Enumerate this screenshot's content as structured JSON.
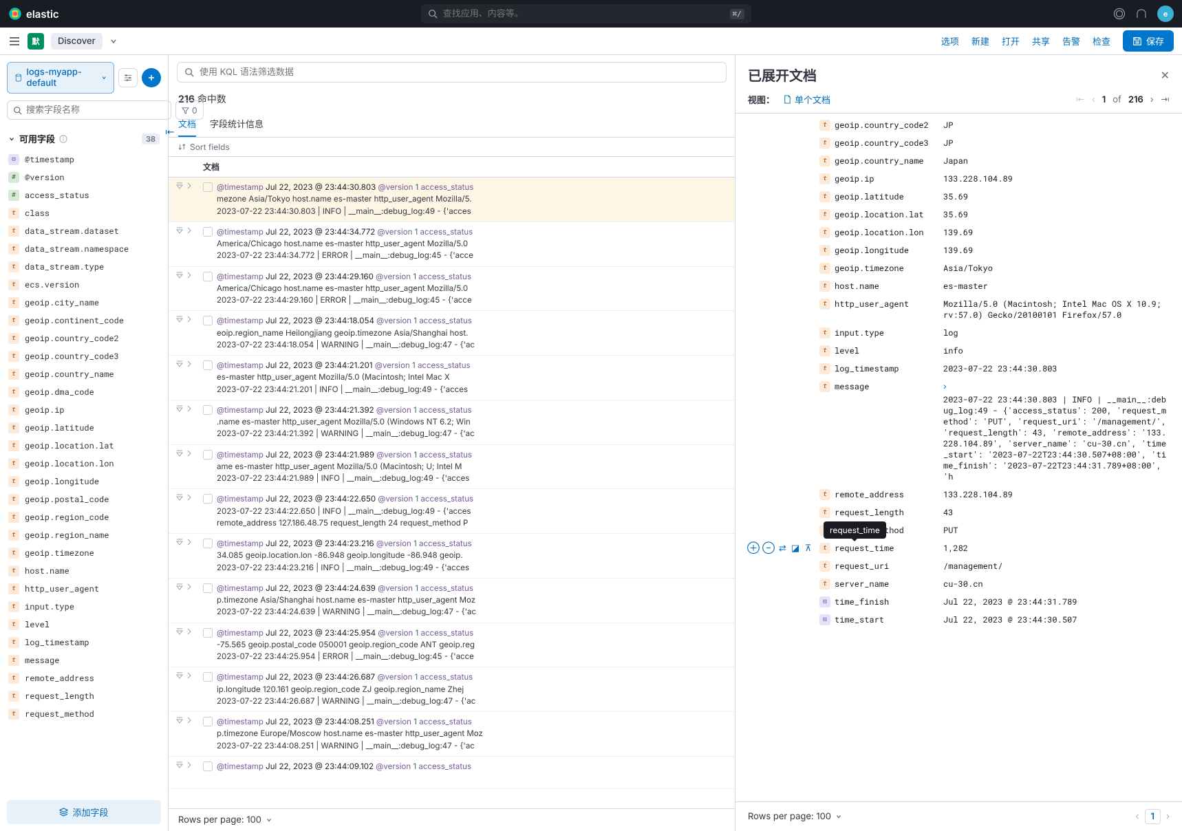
{
  "topbar": {
    "brand": "elastic",
    "search_placeholder": "查找应用、内容等。",
    "shortcut": "⌘/",
    "avatar": "e"
  },
  "subbar": {
    "badge": "默",
    "title": "Discover",
    "links": [
      "选项",
      "新建",
      "打开",
      "共享",
      "告警",
      "检查"
    ],
    "save": "保存"
  },
  "sidebar": {
    "datasource": "logs-myapp-default",
    "field_search_placeholder": "搜索字段名称",
    "filter_count": "0",
    "section": "可用字段",
    "section_count": "38",
    "fields": [
      {
        "t": "date",
        "n": "@timestamp"
      },
      {
        "t": "num",
        "n": "@version"
      },
      {
        "t": "num",
        "n": "access_status"
      },
      {
        "t": "text",
        "n": "class"
      },
      {
        "t": "text",
        "n": "data_stream.dataset"
      },
      {
        "t": "text",
        "n": "data_stream.namespace"
      },
      {
        "t": "text",
        "n": "data_stream.type"
      },
      {
        "t": "text",
        "n": "ecs.version"
      },
      {
        "t": "text",
        "n": "geoip.city_name"
      },
      {
        "t": "text",
        "n": "geoip.continent_code"
      },
      {
        "t": "text",
        "n": "geoip.country_code2"
      },
      {
        "t": "text",
        "n": "geoip.country_code3"
      },
      {
        "t": "text",
        "n": "geoip.country_name"
      },
      {
        "t": "text",
        "n": "geoip.dma_code"
      },
      {
        "t": "text",
        "n": "geoip.ip"
      },
      {
        "t": "text",
        "n": "geoip.latitude"
      },
      {
        "t": "text",
        "n": "geoip.location.lat"
      },
      {
        "t": "text",
        "n": "geoip.location.lon"
      },
      {
        "t": "text",
        "n": "geoip.longitude"
      },
      {
        "t": "text",
        "n": "geoip.postal_code"
      },
      {
        "t": "text",
        "n": "geoip.region_code"
      },
      {
        "t": "text",
        "n": "geoip.region_name"
      },
      {
        "t": "text",
        "n": "geoip.timezone"
      },
      {
        "t": "text",
        "n": "host.name"
      },
      {
        "t": "text",
        "n": "http_user_agent"
      },
      {
        "t": "text",
        "n": "input.type"
      },
      {
        "t": "text",
        "n": "level"
      },
      {
        "t": "text",
        "n": "log_timestamp"
      },
      {
        "t": "text",
        "n": "message"
      },
      {
        "t": "text",
        "n": "remote_address"
      },
      {
        "t": "text",
        "n": "request_length"
      },
      {
        "t": "text",
        "n": "request_method"
      }
    ],
    "add_field": "添加字段"
  },
  "query": {
    "placeholder": "使用 KQL 语法筛选数据",
    "hits_count": "216",
    "hits_label": " 命中数",
    "tabs": [
      "文档",
      "字段统计信息"
    ],
    "sort_label": "Sort fields",
    "col_header": "文档",
    "rows_per_page": "Rows per page: 100"
  },
  "docs": [
    {
      "sel": true,
      "t": "Jul 22, 2023 @ 23:44:30.803",
      "l1": "mezone Asia/Tokyo host.name es-master http_user_agent Mozilla/5.",
      "l2": "2023-07-22 23:44:30.803 | INFO | __main__:debug_log:49 - {'acces"
    },
    {
      "t": "Jul 22, 2023 @ 23:44:34.772",
      "l1": "America/Chicago host.name es-master http_user_agent Mozilla/5.0",
      "l2": "2023-07-22 23:44:34.772 | ERROR | __main__:debug_log:45 - {'acce"
    },
    {
      "t": "Jul 22, 2023 @ 23:44:29.160",
      "l1": "America/Chicago host.name es-master http_user_agent Mozilla/5.0",
      "l2": "2023-07-22 23:44:29.160 | ERROR | __main__:debug_log:45 - {'acce"
    },
    {
      "t": "Jul 22, 2023 @ 23:44:18.054",
      "l1": "eoip.region_name Heilongjiang geoip.timezone Asia/Shanghai host.",
      "l2": "2023-07-22 23:44:18.054 | WARNING | __main__:debug_log:47 - {'ac"
    },
    {
      "t": "Jul 22, 2023 @ 23:44:21.201",
      "l1": "es-master http_user_agent Mozilla/5.0 (Macintosh; Intel Mac X",
      "l2": "2023-07-22 23:44:21.201 | INFO | __main__:debug_log:49 - {'acces"
    },
    {
      "t": "Jul 22, 2023 @ 23:44:21.392",
      "l1": ".name es-master http_user_agent Mozilla/5.0 (Windows NT 6.2; Win",
      "l2": "2023-07-22 23:44:21.392 | WARNING | __main__:debug_log:47 - {'ac"
    },
    {
      "t": "Jul 22, 2023 @ 23:44:21.989",
      "l1": "ame es-master http_user_agent Mozilla/5.0 (Macintosh; U; Intel M",
      "l2": "2023-07-22 23:44:21.989 | INFO | __main__:debug_log:49 - {'acces"
    },
    {
      "t": "Jul 22, 2023 @ 23:44:22.650",
      "l1": "2023-07-22 23:44:22.650 | INFO | __main__:debug_log:49 - {'acces",
      "l2": "  remote_address 127.186.48.75 request_length 24 request_method P"
    },
    {
      "t": "Jul 22, 2023 @ 23:44:23.216",
      "l1": "34.085 geoip.location.lon -86.948 geoip.longitude -86.948 geoip.",
      "l2": "2023-07-22 23:44:23.216 | INFO | __main__:debug_log:49 - {'acces"
    },
    {
      "t": "Jul 22, 2023 @ 23:44:24.639",
      "l1": "p.timezone Asia/Shanghai host.name es-master http_user_agent Moz",
      "l2": "2023-07-22 23:44:24.639 | WARNING | __main__:debug_log:47 - {'ac"
    },
    {
      "t": "Jul 22, 2023 @ 23:44:25.954",
      "l1": "-75.565 geoip.postal_code 050001 geoip.region_code ANT geoip.reg",
      "l2": "2023-07-22 23:44:25.954 | ERROR | __main__:debug_log:45 - {'acce"
    },
    {
      "t": "Jul 22, 2023 @ 23:44:26.687",
      "l1": "ip.longitude 120.161 geoip.region_code ZJ geoip.region_name Zhej",
      "l2": "2023-07-22 23:44:26.687 | WARNING | __main__:debug_log:47 - {'ac"
    },
    {
      "t": "Jul 22, 2023 @ 23:44:08.251",
      "l1": "p.timezone Europe/Moscow host.name es-master http_user_agent Moz",
      "l2": "2023-07-22 23:44:08.251 | WARNING | __main__:debug_log:47 - {'ac"
    },
    {
      "t": "Jul 22, 2023 @ 23:44:09.102",
      "l1": "",
      "l2": ""
    }
  ],
  "flyout": {
    "title": "已展开文档",
    "view_label": "视图：",
    "single_doc": "单个文档",
    "page_current": "1",
    "page_of": "of",
    "page_total": "216",
    "rows_per_page": "Rows per page: 100",
    "page_num": "1",
    "tooltip": "request_time",
    "fields": [
      {
        "t": "text",
        "n": "geoip.country_code2",
        "v": "JP"
      },
      {
        "t": "text",
        "n": "geoip.country_code3",
        "v": "JP"
      },
      {
        "t": "text",
        "n": "geoip.country_name",
        "v": "Japan"
      },
      {
        "t": "text",
        "n": "geoip.ip",
        "v": "133.228.104.89"
      },
      {
        "t": "text",
        "n": "geoip.latitude",
        "v": "35.69"
      },
      {
        "t": "text",
        "n": "geoip.location.lat",
        "v": "35.69"
      },
      {
        "t": "text",
        "n": "geoip.location.lon",
        "v": "139.69"
      },
      {
        "t": "text",
        "n": "geoip.longitude",
        "v": "139.69"
      },
      {
        "t": "text",
        "n": "geoip.timezone",
        "v": "Asia/Tokyo"
      },
      {
        "t": "text",
        "n": "host.name",
        "v": "es-master"
      },
      {
        "t": "text",
        "n": "http_user_agent",
        "v": "Mozilla/5.0 (Macintosh; Intel Mac OS X 10.9; rv:57.0) Gecko/20100101 Firefox/57.0"
      },
      {
        "t": "text",
        "n": "input.type",
        "v": "log"
      },
      {
        "t": "text",
        "n": "level",
        "v": "info"
      },
      {
        "t": "text",
        "n": "log_timestamp",
        "v": "2023-07-22 23:44:30.803"
      },
      {
        "t": "text",
        "n": "message",
        "v": "2023-07-22 23:44:30.803 | INFO    | __main__:debug_log:49 - {'access_status': 200, 'request_method': 'PUT', 'request_uri': '/management/', 'request_length': 43, 'remote_address': '133.228.104.89', 'server_name': 'cu-30.cn', 'time_start': '2023-07-22T23:44:30.507+08:00', 'time_finish': '2023-07-22T23:44:31.789+08:00', 'h",
        "msg": true
      },
      {
        "t": "text",
        "n": "remote_address",
        "v": "133.228.104.89"
      },
      {
        "t": "text",
        "n": "request_length",
        "v": "43"
      },
      {
        "t": "text",
        "n": "request_method",
        "v": "PUT"
      },
      {
        "t": "text",
        "n": "request_time",
        "v": "1,282",
        "act": true,
        "tip": true
      },
      {
        "t": "text",
        "n": "request_uri",
        "v": "/management/"
      },
      {
        "t": "text",
        "n": "server_name",
        "v": "cu-30.cn"
      },
      {
        "t": "date",
        "n": "time_finish",
        "v": "Jul 22, 2023 @ 23:44:31.789"
      },
      {
        "t": "date",
        "n": "time_start",
        "v": "Jul 22, 2023 @ 23:44:30.507"
      }
    ]
  }
}
